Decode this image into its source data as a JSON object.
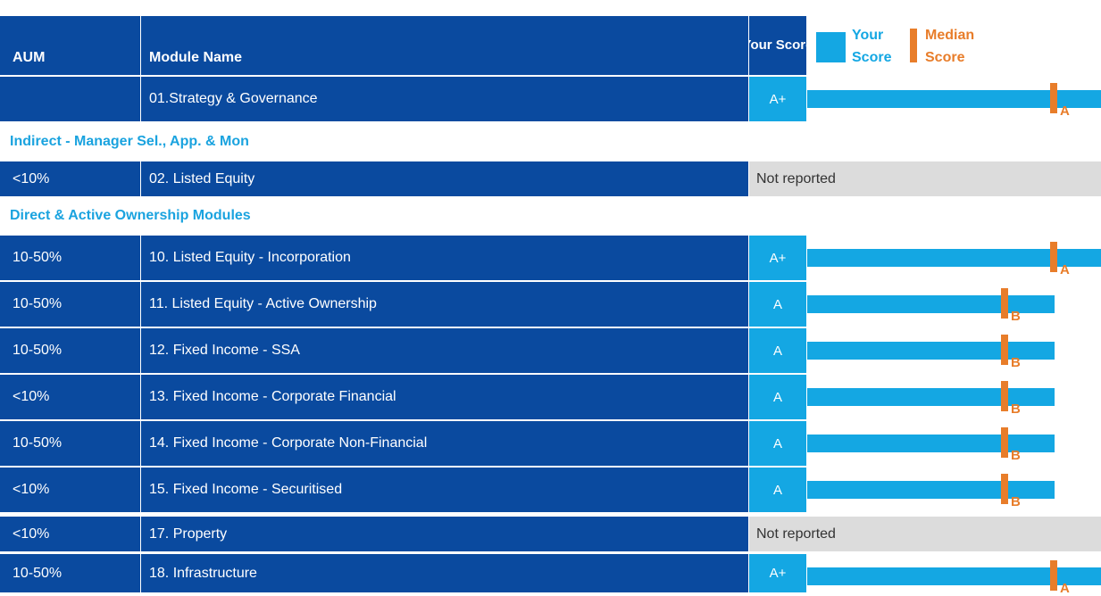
{
  "header": {
    "aum": "AUM",
    "module_name": "Module Name",
    "your_score": "Your Score"
  },
  "legend": {
    "your_score": "Your Score",
    "median_score": "Median Score",
    "your_score_color": "#14a7e3",
    "median_color": "#e87d2a"
  },
  "colors": {
    "header_bg": "#0a4a9f",
    "score_bg": "#14a7e3",
    "section_text": "#1aa3df",
    "not_reported_bg": "#dcdcdc"
  },
  "sections": [
    {
      "label": "Indirect - Manager Sel., App. & Mon"
    },
    {
      "label": "Direct & Active Ownership Modules"
    }
  ],
  "chart_data": {
    "type": "bar",
    "scale_grades": [
      "E",
      "D",
      "C",
      "B",
      "A",
      "A+"
    ],
    "columns": [
      "AUM",
      "Module Name",
      "Your Score"
    ],
    "rows": [
      {
        "aum": "",
        "module": "01.Strategy & Governance",
        "score": "A+",
        "median": "A"
      },
      {
        "aum": "<10%",
        "module": "02. Listed Equity",
        "score": "Not reported",
        "median": null
      },
      {
        "aum": "10-50%",
        "module": "10. Listed Equity - Incorporation",
        "score": "A+",
        "median": "A"
      },
      {
        "aum": "10-50%",
        "module": "11. Listed Equity - Active Ownership",
        "score": "A",
        "median": "B"
      },
      {
        "aum": "10-50%",
        "module": "12. Fixed Income - SSA",
        "score": "A",
        "median": "B"
      },
      {
        "aum": "<10%",
        "module": "13. Fixed Income - Corporate Financial",
        "score": "A",
        "median": "B"
      },
      {
        "aum": "10-50%",
        "module": "14. Fixed Income - Corporate Non-Financial",
        "score": "A",
        "median": "B"
      },
      {
        "aum": "<10%",
        "module": "15. Fixed Income - Securitised",
        "score": "A",
        "median": "B"
      },
      {
        "aum": "<10%",
        "module": "17. Property",
        "score": "Not reported",
        "median": null
      },
      {
        "aum": "10-50%",
        "module": "18. Infrastructure",
        "score": "A+",
        "median": "A"
      }
    ]
  }
}
